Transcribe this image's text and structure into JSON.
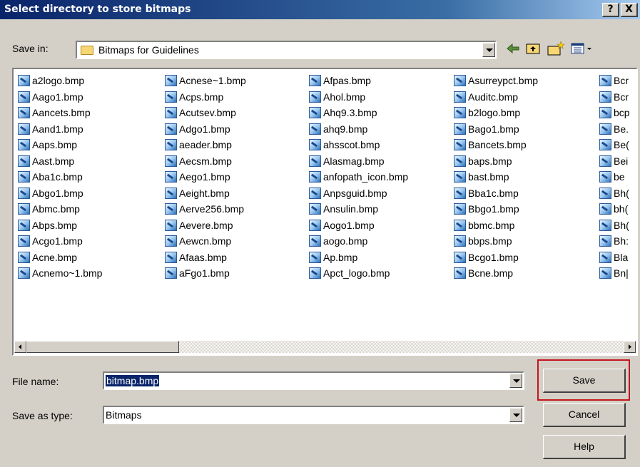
{
  "window": {
    "title": "Select directory to store bitmaps",
    "help_btn": "?",
    "close_btn": "X"
  },
  "toolbar": {
    "save_in_label": "Save in:",
    "location": "Bitmaps for Guidelines",
    "back_icon": "←",
    "up_icon": "up-folder-icon",
    "new_folder_icon": "new-folder-icon",
    "views_icon": "views-menu-icon"
  },
  "files": {
    "columns": [
      [
        "a2logo.bmp",
        "Aago1.bmp",
        "Aancets.bmp",
        "Aand1.bmp",
        "Aaps.bmp",
        "Aast.bmp",
        "Aba1c.bmp",
        "Abgo1.bmp",
        "Abmc.bmp",
        "Abps.bmp",
        "Acgo1.bmp",
        "Acne.bmp",
        "Acnemo~1.bmp"
      ],
      [
        "Acnese~1.bmp",
        "Acps.bmp",
        "Acutsev.bmp",
        "Adgo1.bmp",
        "aeader.bmp",
        "Aecsm.bmp",
        "Aego1.bmp",
        "Aeight.bmp",
        "Aerve256.bmp",
        "Aevere.bmp",
        "Aewcn.bmp",
        "Afaas.bmp",
        "aFgo1.bmp"
      ],
      [
        "Afpas.bmp",
        "Ahol.bmp",
        "Ahq9.3.bmp",
        "ahq9.bmp",
        "ahsscot.bmp",
        "Alasmag.bmp",
        "anfopath_icon.bmp",
        "Anpsguid.bmp",
        "Ansulin.bmp",
        "Aogo1.bmp",
        "aogo.bmp",
        "Ap.bmp",
        "Apct_logo.bmp"
      ],
      [
        "Asurreypct.bmp",
        "Auditc.bmp",
        "b2logo.bmp",
        "Bago1.bmp",
        "Bancets.bmp",
        "baps.bmp",
        "bast.bmp",
        "Bba1c.bmp",
        "Bbgo1.bmp",
        "bbmc.bmp",
        "bbps.bmp",
        "Bcgo1.bmp",
        "Bcne.bmp"
      ],
      [
        "Bcr",
        "Bcr",
        "bcp",
        "Be.",
        "Be(",
        "Bei",
        "be",
        "Bh(",
        "bh(",
        "Bh(",
        "Bh:",
        "Bla",
        "Bn|"
      ]
    ]
  },
  "form": {
    "file_name_label": "File name:",
    "file_name_value": "bitmap.bmp",
    "save_as_type_label": "Save as type:",
    "save_as_type_value": "Bitmaps",
    "save_button": "Save",
    "cancel_button": "Cancel",
    "help_button": "Help"
  },
  "colors": {
    "highlight_border": "#c4161c",
    "selection": "#0a246a",
    "face": "#d4d0c8"
  }
}
